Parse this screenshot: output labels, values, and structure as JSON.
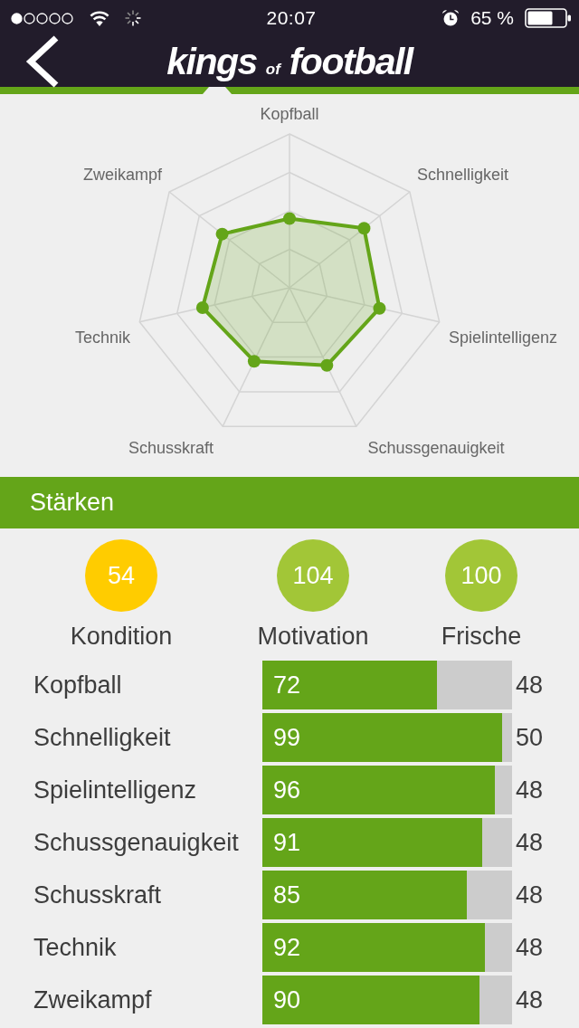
{
  "status_bar": {
    "time": "20:07",
    "battery": "65 %"
  },
  "header": {
    "logo": [
      "kings",
      "of",
      "football"
    ]
  },
  "radar": {
    "axes": [
      "Kopfball",
      "Zweikampf",
      "Schnelligkeit",
      "Technik",
      "Spielintelligenz",
      "Schusskraft",
      "Schussgenauigkeit"
    ]
  },
  "section": {
    "title": "Stärken"
  },
  "stats": [
    {
      "value": "54",
      "label": "Kondition",
      "color": "#ffcc00"
    },
    {
      "value": "104",
      "label": "Motivation",
      "color": "#a2c637"
    },
    {
      "value": "100",
      "label": "Frische",
      "color": "#a2c637"
    }
  ],
  "skills": [
    {
      "name": "Kopfball",
      "value": "72",
      "level": 0.7,
      "reading": "48"
    },
    {
      "name": "Schnelligkeit",
      "value": "99",
      "level": 0.96,
      "reading": "50"
    },
    {
      "name": "Spielintelligenz",
      "value": "96",
      "level": 0.93,
      "reading": "48"
    },
    {
      "name": "Schussgenauigkeit",
      "value": "91",
      "level": 0.88,
      "reading": "48"
    },
    {
      "name": "Schusskraft",
      "value": "85",
      "level": 0.82,
      "reading": "48"
    },
    {
      "name": "Technik",
      "value": "92",
      "level": 0.89,
      "reading": "48"
    },
    {
      "name": "Zweikampf",
      "value": "90",
      "level": 0.87,
      "reading": "48"
    }
  ]
}
